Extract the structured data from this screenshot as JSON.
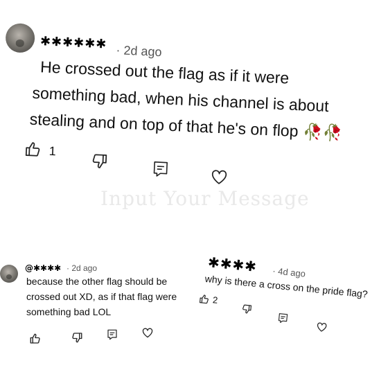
{
  "comment_main": {
    "handle": "✱✱✱✱✱✱",
    "meta": "· 2d ago",
    "line1": "He crossed out the flag as if it were",
    "line2": "something bad, when his channel is about",
    "line3": "stealing and on top of that he's on flop 🥀🥀",
    "like_count": "1"
  },
  "watermark": "Input Your Message",
  "reply_left": {
    "handle": "@✱✱✱✱",
    "meta": "· 2d ago",
    "line1": "because the other flag should be",
    "line2": "crossed out XD, as if that flag were",
    "line3": "something bad LOL"
  },
  "reply_right": {
    "handle": "✱✱✱✱",
    "meta": "· 4d ago",
    "line1": "why is there a cross on the pride flag?",
    "like_count": "2"
  },
  "icons": [
    "thumb-up-icon",
    "thumb-down-icon",
    "reply-icon",
    "heart-icon"
  ]
}
